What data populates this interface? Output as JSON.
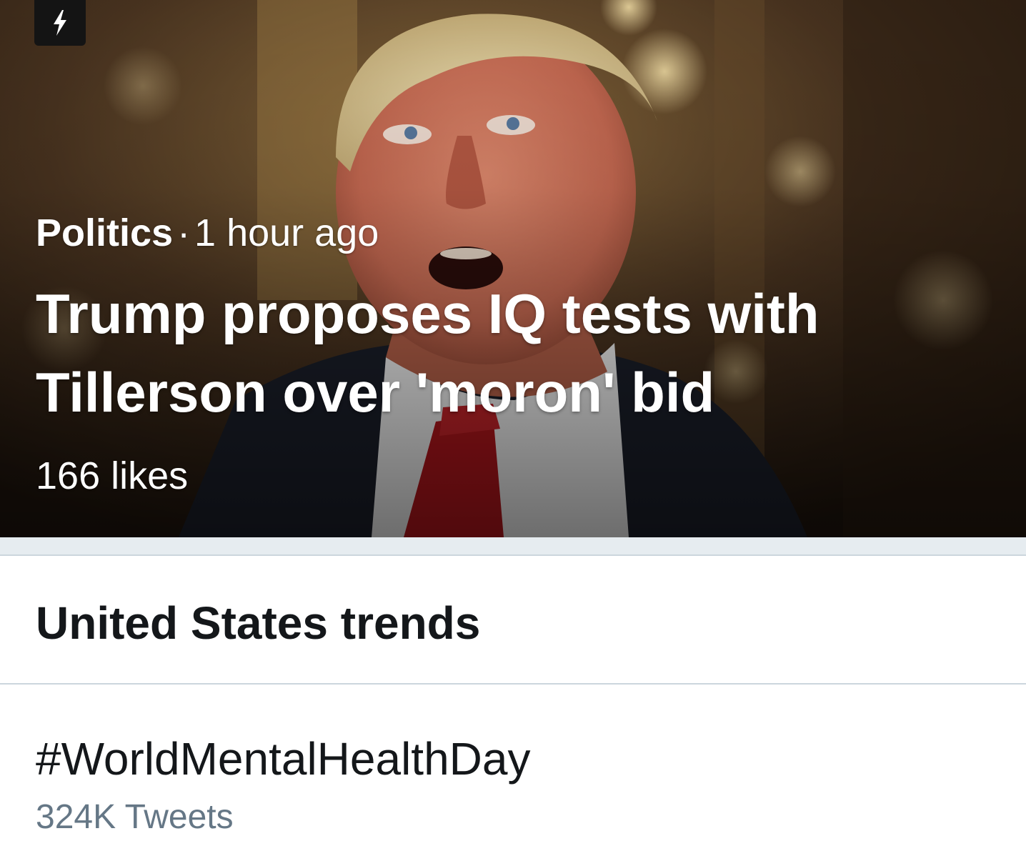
{
  "moment": {
    "category": "Politics",
    "separator": "·",
    "time": "1 hour ago",
    "headline": "Trump proposes IQ tests with Tillerson over 'moron' bid",
    "likes": "166 likes",
    "badge_icon": "lightning-icon"
  },
  "trends": {
    "title": "United States trends",
    "items": [
      {
        "name": "#WorldMentalHealthDay",
        "count": "324K Tweets"
      }
    ]
  },
  "colors": {
    "text_primary": "#14171a",
    "text_secondary": "#657786",
    "divider": "#ccd6dd",
    "section_gap": "#e6ecf0",
    "badge_bg": "#141414"
  }
}
